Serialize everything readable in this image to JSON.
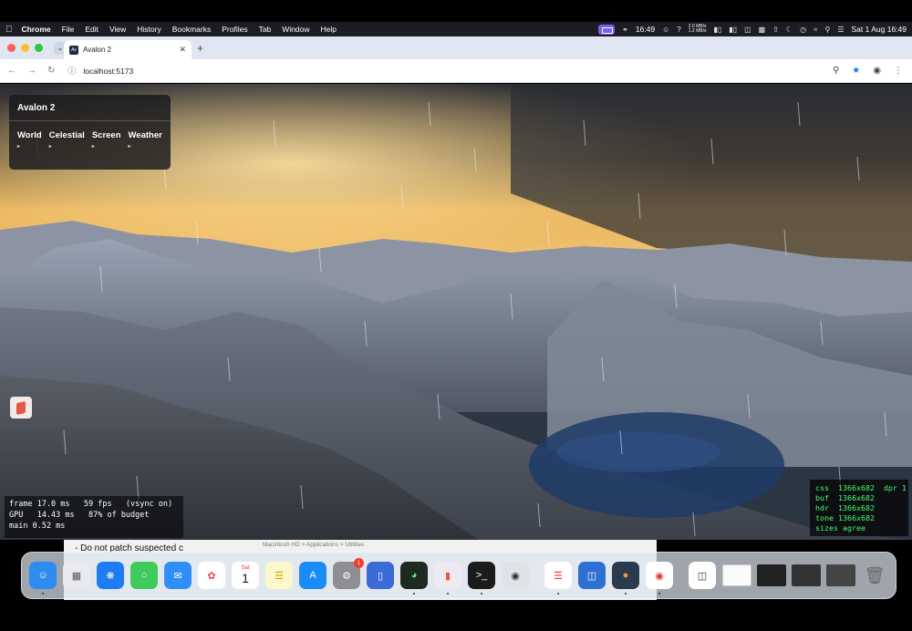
{
  "menubar": {
    "items": [
      "Chrome",
      "File",
      "Edit",
      "View",
      "History",
      "Bookmarks",
      "Profiles",
      "Tab",
      "Window",
      "Help"
    ],
    "time": "16:49",
    "net_up": "2.0 MB/s",
    "net_down": "1.2 MB/s",
    "date_time": "Sat 1 Aug  16:49"
  },
  "browser": {
    "tab_title": "Avalon 2",
    "url": "localhost:5173"
  },
  "panel": {
    "title": "Avalon 2",
    "tabs": [
      "World",
      "Celestial",
      "Screen",
      "Weather"
    ]
  },
  "stats": {
    "line1": "frame 17.0 ms   59 fps   (vsync on)",
    "line2": "GPU   14.43 ms   87% of budget",
    "line3": "main 0.52 ms"
  },
  "sizes": {
    "line1": "css  1366x682  dpr 1",
    "line2": "buf  1366x682",
    "line3": "hdr  1366x682",
    "line4": "tone 1366x682",
    "line5": "sizes agree"
  },
  "behind": {
    "doc_line": "- Do not patch suspected c",
    "finder_path": "Macintosh HD > Applications > Utilities"
  },
  "dock": {
    "calendar_month": "Sat",
    "calendar_day": "1",
    "settings_badge": "1"
  },
  "colors": {
    "overlay_text": "#49ff6a",
    "accent": "#1a73e8"
  }
}
